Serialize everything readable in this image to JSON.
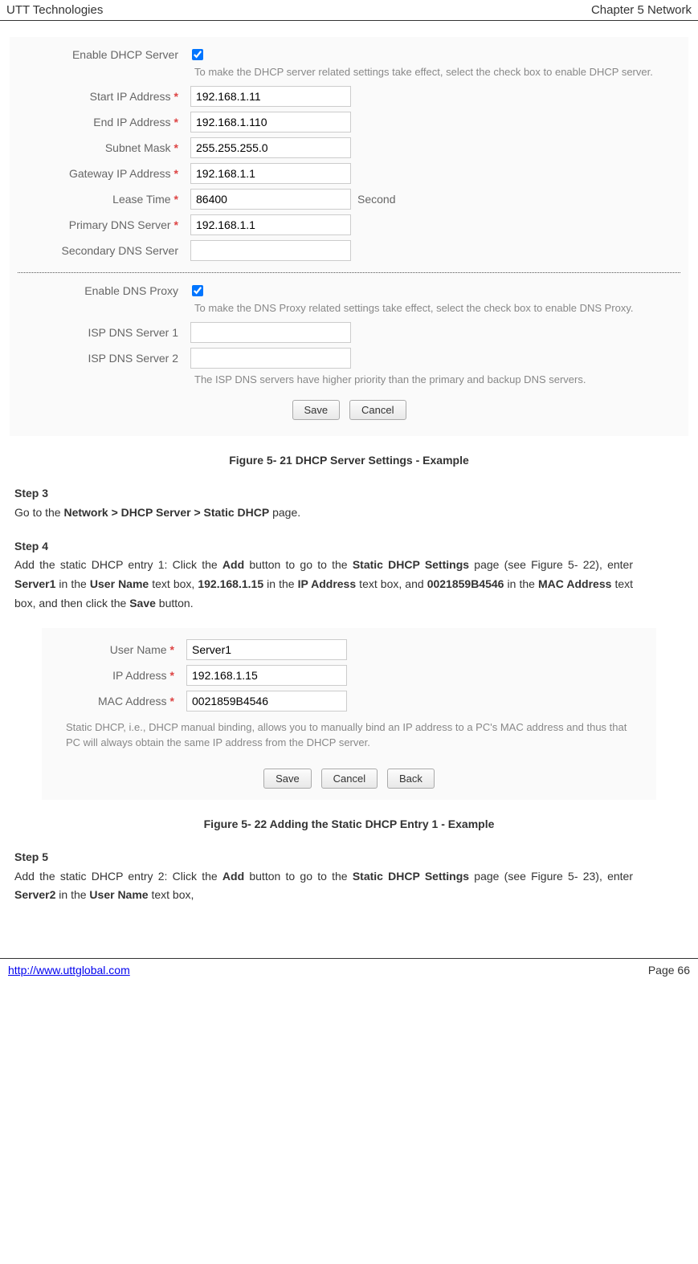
{
  "header": {
    "left": "UTT Technologies",
    "right": "Chapter 5 Network"
  },
  "dhcp": {
    "enable_label": "Enable DHCP Server",
    "enable_help": "To make the DHCP server related settings take effect, select the check box to enable DHCP server.",
    "start_ip_label": "Start IP Address",
    "start_ip_value": "192.168.1.11",
    "end_ip_label": "End IP Address",
    "end_ip_value": "192.168.1.110",
    "subnet_label": "Subnet Mask",
    "subnet_value": "255.255.255.0",
    "gateway_label": "Gateway IP Address",
    "gateway_value": "192.168.1.1",
    "lease_label": "Lease Time",
    "lease_value": "86400",
    "lease_unit": "Second",
    "primary_dns_label": "Primary DNS Server",
    "primary_dns_value": "192.168.1.1",
    "secondary_dns_label": "Secondary DNS Server",
    "secondary_dns_value": ""
  },
  "dns": {
    "enable_label": "Enable DNS Proxy",
    "enable_help": "To make the DNS Proxy related settings take effect, select the check box to enable DNS Proxy.",
    "isp1_label": "ISP DNS Server 1",
    "isp1_value": "",
    "isp2_label": "ISP DNS Server 2",
    "isp2_value": "",
    "priority_help": "The ISP DNS servers have higher priority than the primary and backup DNS servers."
  },
  "buttons": {
    "save": "Save",
    "cancel": "Cancel",
    "back": "Back"
  },
  "figure1_caption": "Figure 5- 21 DHCP Server Settings - Example",
  "step3": {
    "label": "Step 3",
    "text_pre": "Go to the ",
    "path": "Network > DHCP Server > Static DHCP",
    "text_post": " page."
  },
  "step4": {
    "label": "Step 4",
    "full": "Add the static DHCP entry 1: Click the Add button to go to the Static DHCP Settings page (see Figure 5-22), enter Server1 in the User Name text box, 192.168.1.15 in the IP Address text box, and 0021859B4546 in the MAC Address text box, and then click the Save button."
  },
  "static": {
    "user_label": "User Name",
    "user_value": "Server1",
    "ip_label": "IP Address",
    "ip_value": "192.168.1.15",
    "mac_label": "MAC Address",
    "mac_value": "0021859B4546",
    "help": "Static DHCP, i.e., DHCP manual binding, allows you to manually bind an IP address to a PC's MAC address and thus that PC will always obtain the same IP address from the DHCP server."
  },
  "figure2_caption": "Figure 5- 22 Adding the Static DHCP Entry 1 - Example",
  "step5": {
    "label": "Step 5",
    "full": "Add the static DHCP entry 2: Click the Add button to go to the Static DHCP Settings page (see Figure 5-23), enter Server2 in the User Name text box,"
  },
  "footer": {
    "url": "http://www.uttglobal.com",
    "page": "Page 66"
  }
}
